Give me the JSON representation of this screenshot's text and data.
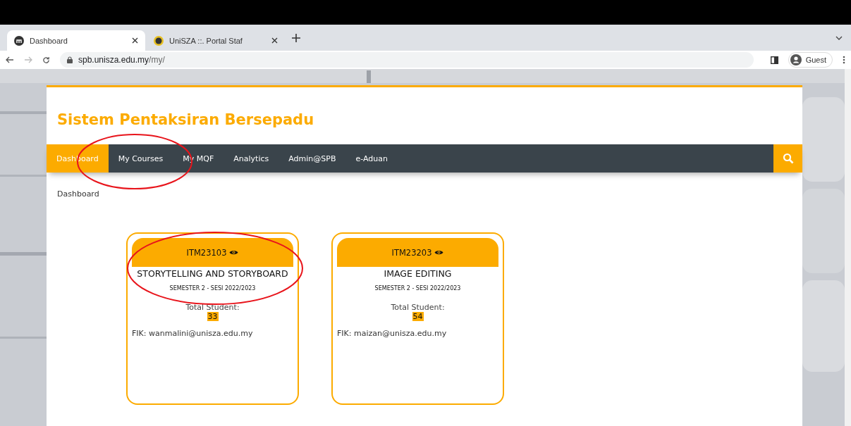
{
  "browser": {
    "tabs": [
      {
        "title": "Dashboard",
        "selected": true
      },
      {
        "title": "UniSZA ::. Portal Staf",
        "selected": false
      }
    ],
    "url_host": "spb.unisza.edu.my",
    "url_path": "/my/",
    "profile": "Guest"
  },
  "site_title": "Sistem Pentaksiran Bersepadu",
  "nav": [
    {
      "label": "Dashboard",
      "selected": true
    },
    {
      "label": "My Courses",
      "selected": false
    },
    {
      "label": "My MQF",
      "selected": false
    },
    {
      "label": "Analytics",
      "selected": false
    },
    {
      "label": "Admin@SPB",
      "selected": false
    },
    {
      "label": "e-Aduan",
      "selected": false
    }
  ],
  "breadcrumb": "Dashboard",
  "courses": [
    {
      "code": "ITM23103",
      "name": "STORYTELLING AND STORYBOARD",
      "semester": "SEMESTER 2 - SESI 2022/2023",
      "students_label": "Total Student:",
      "students": "33",
      "lecturer": "FIK: wanmalini@unisza.edu.my"
    },
    {
      "code": "ITM23203",
      "name": "IMAGE EDITING",
      "semester": "SEMESTER 2 - SESI 2022/2023",
      "students_label": "Total Student:",
      "students": "54",
      "lecturer": "FIK: maizan@unisza.edu.my"
    }
  ],
  "annotations": [
    {
      "kind": "ellipse"
    },
    {
      "kind": "ellipse"
    }
  ]
}
